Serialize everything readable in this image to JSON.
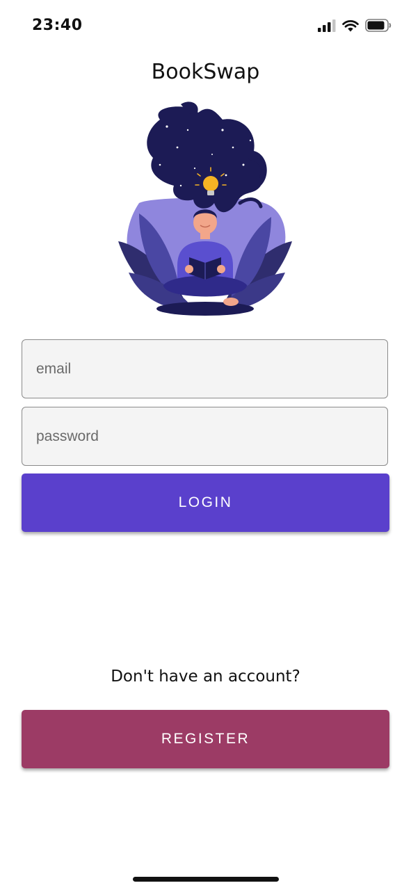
{
  "status_bar": {
    "time": "23:40"
  },
  "app": {
    "title": "BookSwap"
  },
  "form": {
    "email_placeholder": "email",
    "password_placeholder": "password",
    "login_label": "LOGIN"
  },
  "register_section": {
    "prompt": "Don't have an account?",
    "register_label": "REGISTER"
  },
  "colors": {
    "login_button": "#5a40cc",
    "register_button": "#9c3b65",
    "field_background": "#f4f4f4"
  },
  "icons": [
    "cellular-signal-icon",
    "wifi-icon",
    "battery-icon",
    "reading-woman-illustration"
  ]
}
